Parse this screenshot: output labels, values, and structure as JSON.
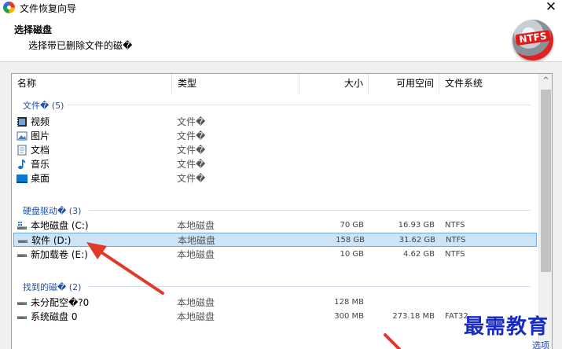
{
  "window": {
    "title": "文件恢复向导",
    "close_glyph": "✕"
  },
  "header": {
    "title": "选择磁盘",
    "subtitle": "选择带已删除文件的磁�",
    "logo_text": "NTFS"
  },
  "columns": {
    "name": "名称",
    "type": "类型",
    "size": "大小",
    "free": "可用空间",
    "fs": "文件系统"
  },
  "groups": [
    {
      "label": "文件� (5)",
      "items": [
        {
          "icon": "video-icon",
          "name": "视频",
          "type": "文件�"
        },
        {
          "icon": "image-icon",
          "name": "图片",
          "type": "文件�"
        },
        {
          "icon": "document-icon",
          "name": "文档",
          "type": "文件�"
        },
        {
          "icon": "music-note-icon",
          "name": "音乐",
          "type": "文件�"
        },
        {
          "icon": "desktop-icon",
          "name": "桌面",
          "type": "文件�"
        }
      ]
    },
    {
      "label": "硬盘驱动� (3)",
      "items": [
        {
          "icon": "system-drive-icon",
          "name": "本地磁盘 (C:)",
          "type": "本地磁盘",
          "size": "70 GB",
          "free": "16.93 GB",
          "fs": "NTFS"
        },
        {
          "icon": "drive-icon",
          "name": "软件 (D:)",
          "type": "本地磁盘",
          "size": "158 GB",
          "free": "31.62 GB",
          "fs": "NTFS",
          "selected": true
        },
        {
          "icon": "drive-icon",
          "name": "新加载卷 (E:)",
          "type": "本地磁盘",
          "size": "10 GB",
          "free": "4.62 GB",
          "fs": "NTFS"
        }
      ]
    },
    {
      "label": "找到的磁� (2)",
      "items": [
        {
          "icon": "drive-icon",
          "name": "未分配空�?0",
          "type": "本地磁盘",
          "size": "128 MB",
          "free": "",
          "fs": ""
        },
        {
          "icon": "drive-icon",
          "name": "系统磁盘 0",
          "type": "本地磁盘",
          "size": "300 MB",
          "free": "273.18 MB",
          "fs": "FAT32"
        }
      ]
    }
  ],
  "scrollbar": {
    "up_glyph": "^"
  },
  "watermark": "最需教育",
  "footer_link": "选项",
  "colors": {
    "accent": "#1f4fa8",
    "selection": "#cce4f7",
    "arrow": "#e03a2a"
  }
}
